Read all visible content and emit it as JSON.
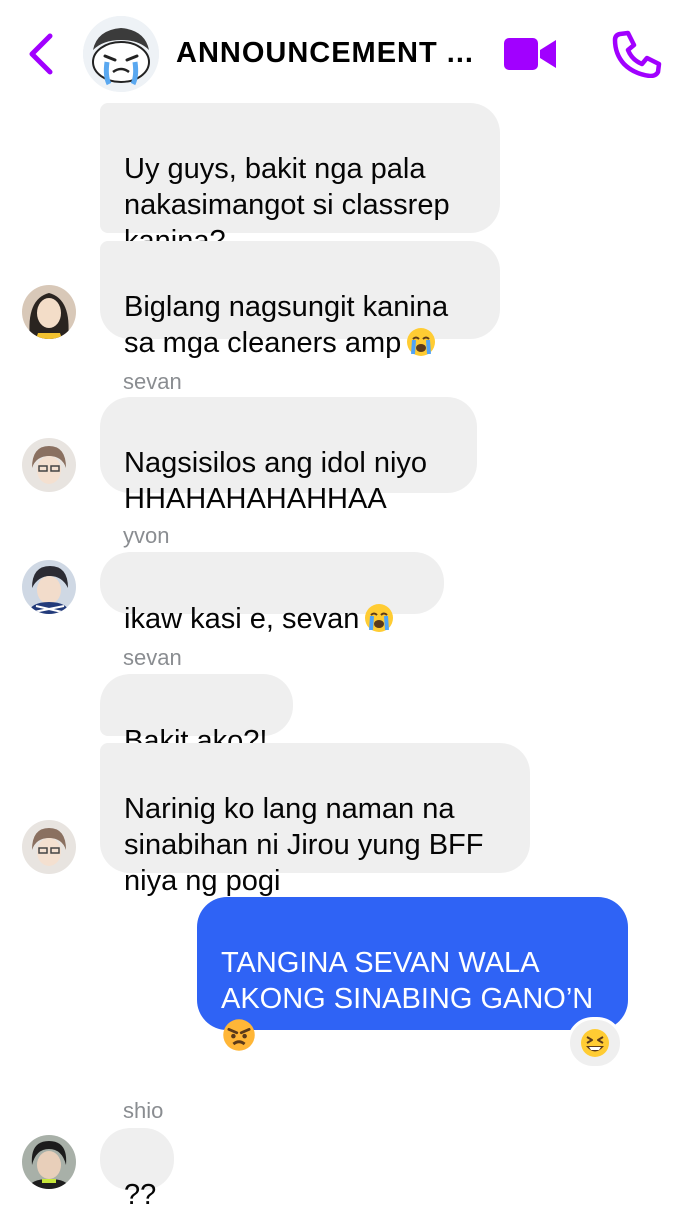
{
  "header": {
    "title": "ANNOUNCEMENT ...",
    "accent_color": "#a100ff"
  },
  "messages": [
    {
      "sender": "",
      "text": "Uy guys, bakit nga pala\nnakasimangot si classrep\nkanina?"
    },
    {
      "sender": "",
      "text": "Biglang nagsungit kanina\nsa mga cleaners amp",
      "emoji": "crying-face"
    },
    {
      "sender": "sevan",
      "text": "Nagsisilos ang idol niyo\nHHAHAHAHAHHAA"
    },
    {
      "sender": "yvon",
      "text": "ikaw kasi e, sevan",
      "emoji": "crying-face"
    },
    {
      "sender": "sevan",
      "text": "Bakit ako?!"
    },
    {
      "sender": "",
      "text": "Narinig ko lang naman na\nsinabihan ni Jirou yung BFF\nniya ng pogi"
    },
    {
      "sender": "me",
      "text": "TANGINA SEVAN WALA\nAKONG SINABING GANO’N",
      "emoji": "angry-face",
      "reaction": "grinning-squinting-face"
    },
    {
      "sender": "shio",
      "text": "??"
    }
  ],
  "labels": {
    "sevan_1": "sevan",
    "yvon": "yvon",
    "sevan_2": "sevan",
    "shio": "shio"
  },
  "colors": {
    "incoming_bubble": "#efefef",
    "outgoing_bubble": "#2f63f5",
    "sender_label": "#8a8d91"
  }
}
